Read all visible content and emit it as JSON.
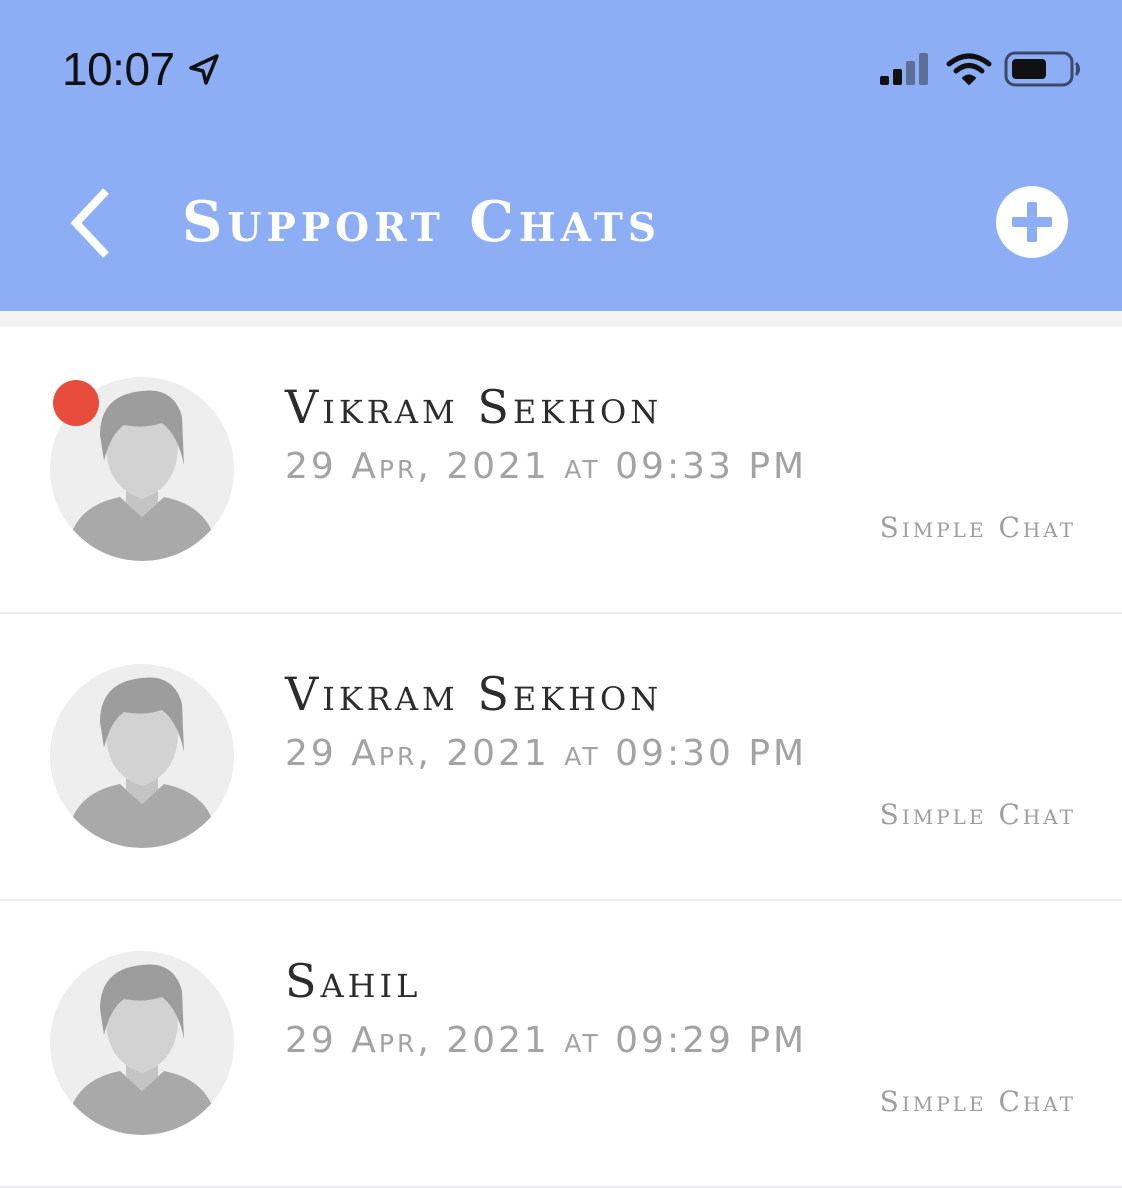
{
  "status_bar": {
    "time": "10:07",
    "icons": [
      "location-arrow-icon",
      "cellular-signal-icon",
      "wifi-icon",
      "battery-icon"
    ]
  },
  "header": {
    "title": "Support Chats",
    "back_icon": "chevron-left-icon",
    "add_icon": "plus-circle-icon",
    "background_color": "#8dadf5"
  },
  "chats": [
    {
      "name": "Vikram Sekhon",
      "time": "29 Apr, 2021 at 09:33 PM",
      "type": "Simple Chat",
      "unread": true
    },
    {
      "name": "Vikram Sekhon",
      "time": "29 Apr, 2021 at 09:30 PM",
      "type": "Simple Chat",
      "unread": false
    },
    {
      "name": "Sahil",
      "time": "29 Apr, 2021 at 09:29 PM",
      "type": "Simple Chat",
      "unread": false
    }
  ],
  "colors": {
    "unread_dot": "#e84c3d",
    "name_text": "#2c2c2c",
    "meta_text": "#a3a3a3"
  }
}
